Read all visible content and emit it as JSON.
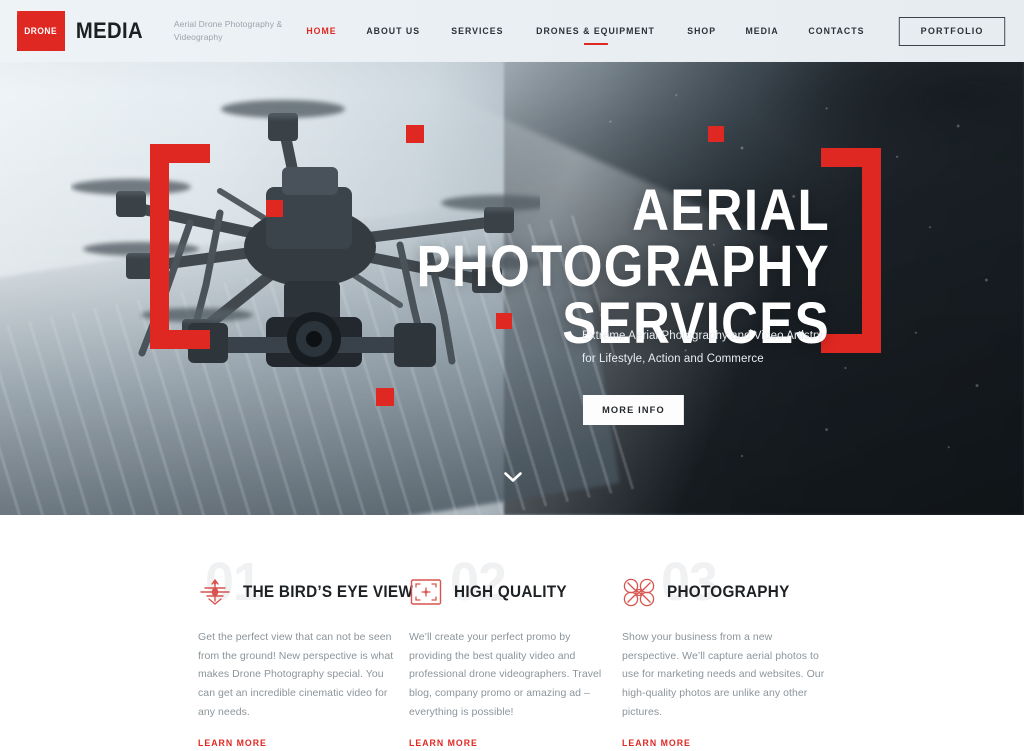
{
  "header": {
    "logo": {
      "badge_text": "DRONE",
      "word": "MEDIA"
    },
    "tagline": "Aerial Drone Photography & Videography",
    "nav": [
      {
        "label": "HOME",
        "active": true,
        "underline": false
      },
      {
        "label": "ABOUT US",
        "active": false,
        "underline": false
      },
      {
        "label": "SERVICES",
        "active": false,
        "underline": false
      },
      {
        "label": "DRONES & EQUIPMENT",
        "active": false,
        "underline": true
      },
      {
        "label": "SHOP",
        "active": false,
        "underline": false
      },
      {
        "label": "MEDIA",
        "active": false,
        "underline": false
      },
      {
        "label": "CONTACTS",
        "active": false,
        "underline": false
      }
    ],
    "portfolio_button": "PORTFOLIO"
  },
  "hero": {
    "title_line1": "AERIAL PHOTOGRAPHY",
    "title_line2": "SERVICES",
    "subtitle": "Extreme Aerial Photography and Video Artistry for Lifestyle, Action and Commerce",
    "cta": "MORE INFO",
    "scroll_icon": "chevron-down-icon"
  },
  "features": [
    {
      "number": "01",
      "icon": "drone-top-view-icon",
      "title": "THE BIRD’S EYE VIEW",
      "body": "Get the perfect view that can not be seen from the ground! New perspective is what makes Drone Photography special. You can get an incredible cinematic video for any needs.",
      "link": "LEARN MORE"
    },
    {
      "number": "02",
      "icon": "viewfinder-frame-icon",
      "title": "HIGH QUALITY",
      "body": "We’ll create your perfect promo by providing the best quality video and professional drone videographers. Travel blog, company promo or amazing ad – everything is possible!",
      "link": "LEARN MORE"
    },
    {
      "number": "03",
      "icon": "quadcopter-icon",
      "title": "PHOTOGRAPHY",
      "body": "Show your business from a new perspective. We’ll capture aerial photos to use for marketing needs and websites. Our high-quality photos are unlike any other pictures.",
      "link": "LEARN MORE"
    }
  ],
  "colors": {
    "accent_red": "#e02822",
    "text_dark": "#1d2124",
    "text_muted": "#8c959b",
    "watermark_gray": "#f0f1f2"
  }
}
